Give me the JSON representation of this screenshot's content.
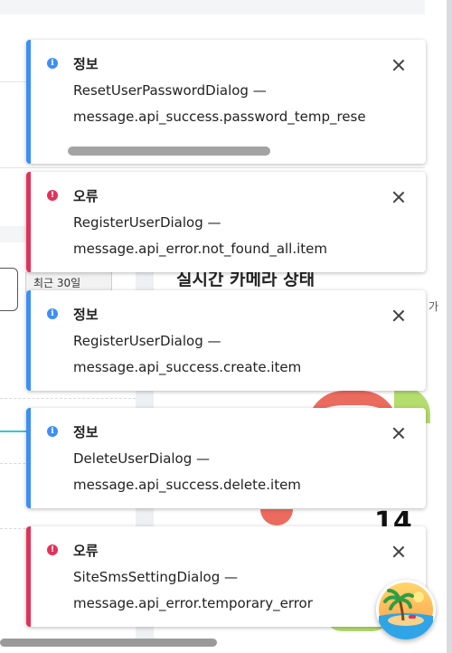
{
  "background": {
    "tab_label": "최근 30일",
    "card_title": "실시간 카메라 상태",
    "edge_text": "가",
    "big_number": "14"
  },
  "toasts": [
    {
      "severity": "info",
      "icon": "info-icon",
      "title": "정보",
      "source": "ResetUserPasswordDialog —",
      "message": "message.api_success.password_temp_reset"
    },
    {
      "severity": "error",
      "icon": "error-icon",
      "title": "오류",
      "source": "RegisterUserDialog —",
      "message": "message.api_error.not_found_all.item"
    },
    {
      "severity": "info",
      "icon": "info-icon",
      "title": "정보",
      "source": "RegisterUserDialog —",
      "message": "message.api_success.create.item"
    },
    {
      "severity": "info",
      "icon": "info-icon",
      "title": "정보",
      "source": "DeleteUserDialog —",
      "message": "message.api_success.delete.item"
    },
    {
      "severity": "error",
      "icon": "error-icon",
      "title": "오류",
      "source": "SiteSmsSettingDialog —",
      "message": "message.api_error.temporary_error"
    }
  ],
  "colors": {
    "info": "#3d8ef5",
    "error": "#e1325a"
  },
  "fab": {
    "icon": "beach-island-avatar-icon"
  }
}
